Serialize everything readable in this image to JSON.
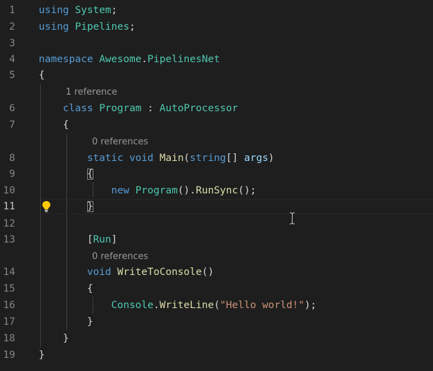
{
  "gutter": {
    "line_numbers": [
      "1",
      "2",
      "3",
      "4",
      "5",
      "6",
      "7",
      "8",
      "9",
      "10",
      "11",
      "12",
      "13",
      "14",
      "15",
      "16",
      "17",
      "18",
      "19"
    ],
    "active_line": "11"
  },
  "codelens": {
    "class_refs": "1 reference",
    "main_refs": "0 references",
    "write_refs": "0 references"
  },
  "code": {
    "l1": {
      "kw": "using",
      "ns": "System",
      "end": ";"
    },
    "l2": {
      "kw": "using",
      "ns": "Pipelines",
      "end": ";"
    },
    "l4": {
      "kw": "namespace",
      "ns1": "Awesome",
      "dot": ".",
      "ns2": "PipelinesNet"
    },
    "l5": {
      "brace": "{"
    },
    "l6": {
      "kw": "class",
      "name": "Program",
      "colon": " : ",
      "base": "AutoProcessor"
    },
    "l7": {
      "brace": "{"
    },
    "l8": {
      "kw1": "static",
      "kw2": "void",
      "fn": "Main",
      "open": "(",
      "kw3": "string",
      "arr": "[] ",
      "param": "args",
      "close": ")"
    },
    "l9": {
      "brace": "{"
    },
    "l10": {
      "kw": "new",
      "type": "Program",
      "p1": "().",
      "fn": "RunSync",
      "p2": "();"
    },
    "l11": {
      "brace": "}"
    },
    "l13": {
      "open": "[",
      "attr": "Run",
      "close": "]"
    },
    "l14": {
      "kw": "void",
      "fn": "WriteToConsole",
      "parens": "()"
    },
    "l15": {
      "brace": "{"
    },
    "l16": {
      "type": "Console",
      "dot": ".",
      "fn": "WriteLine",
      "open": "(",
      "str": "\"Hello world!\"",
      "close": ");"
    },
    "l17": {
      "brace": "}"
    },
    "l18": {
      "brace": "}"
    },
    "l19": {
      "brace": "}"
    }
  },
  "colors": {
    "background": "#1e1e1e",
    "keyword": "#569cd6",
    "type": "#4ec9b0",
    "function": "#dcdcaa",
    "string": "#ce9178",
    "parameter": "#9cdcfe",
    "line_number": "#858585",
    "lightbulb": "#ffcc00"
  },
  "icons": {
    "lightbulb": "lightbulb-icon",
    "text_cursor": "text-cursor-icon"
  }
}
